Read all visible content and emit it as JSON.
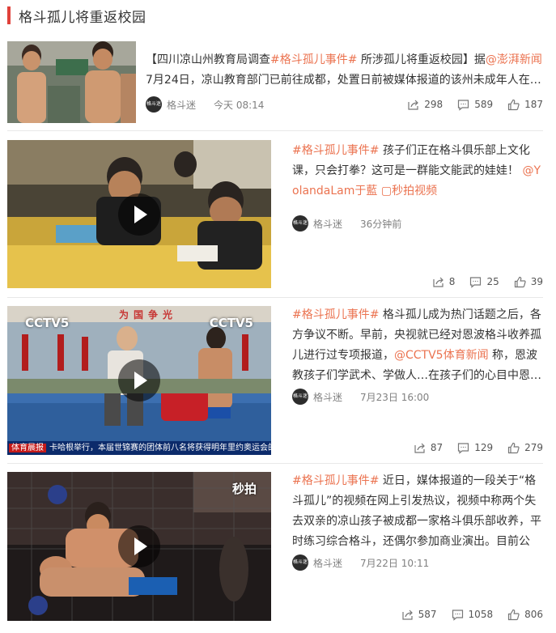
{
  "header": {
    "title": "格斗孤儿将重返校园",
    "accent_color": "#e0413a"
  },
  "link_color": "#eb7350",
  "posts": [
    {
      "text": [
        {
          "t": "【四川凉山州教育局调查",
          "hl": false
        },
        {
          "t": "#格斗孤儿事件#",
          "hl": true
        },
        {
          "t": " 所涉孤儿将重返校园】据",
          "hl": false
        },
        {
          "t": "@澎湃新闻",
          "hl": true
        },
        {
          "t": " 7月24日，凉山教育部门已前往成都，处置日前被媒体报道的该州未成年人在…",
          "hl": false
        }
      ],
      "author": "格斗迷",
      "avatar_text": "格斗迷",
      "time": "今天 08:14",
      "shares": "298",
      "comments": "589",
      "likes": "187",
      "icons": [
        "share-icon",
        "comment-icon",
        "like-icon"
      ]
    },
    {
      "text": [
        {
          "t": "#格斗孤儿事件#",
          "hl": true
        },
        {
          "t": " 孩子们正在格斗俱乐部上文化课，只会打拳？这可是一群能文能武的娃娃！ ",
          "hl": false
        },
        {
          "t": "@YolandaLam于藍",
          "hl": true
        },
        {
          "t": " ",
          "hl": false
        },
        {
          "t": "▢秒拍视频",
          "hl": true
        }
      ],
      "author": "格斗迷",
      "avatar_text": "格斗迷",
      "time": "36分钟前",
      "shares": "8",
      "comments": "25",
      "likes": "39"
    },
    {
      "text": [
        {
          "t": "#格斗孤儿事件#",
          "hl": true
        },
        {
          "t": " 格斗孤儿成为热门话题之后，各方争议不断。早前，央视就已经对恩波格斗收养孤儿进行过专项报道，",
          "hl": false
        },
        {
          "t": "@CCTV5体育新闻",
          "hl": true
        },
        {
          "t": " 称，恩波教孩子们学武术、学做人…在孩子们的心目中恩…",
          "hl": false
        }
      ],
      "author": "格斗迷",
      "avatar_text": "格斗迷",
      "time": "7月23日 16:00",
      "shares": "87",
      "comments": "129",
      "likes": "279",
      "thumb": {
        "watermark": "CCTV5",
        "banner_text": "为国争光",
        "ticker_tag": "体育晨报",
        "ticker": "卡哈根举行，本届世锦赛的团体前八名将获得明年里约奥运会的入场券"
      }
    },
    {
      "text": [
        {
          "t": "#格斗孤儿事件#",
          "hl": true
        },
        {
          "t": " 近日，媒体报道的一段关于“格斗孤儿”的视频在网上引发热议，视频中称两个失去双亲的凉山孩子被成都一家格斗俱乐部收养，平时练习综合格斗，还偶尔参加商业演出。目前公安…",
          "hl": false
        }
      ],
      "author": "格斗迷",
      "avatar_text": "格斗迷",
      "time": "7月22日 10:11",
      "shares": "587",
      "comments": "1058",
      "likes": "806",
      "thumb": {
        "watermark": "秒拍"
      }
    }
  ]
}
